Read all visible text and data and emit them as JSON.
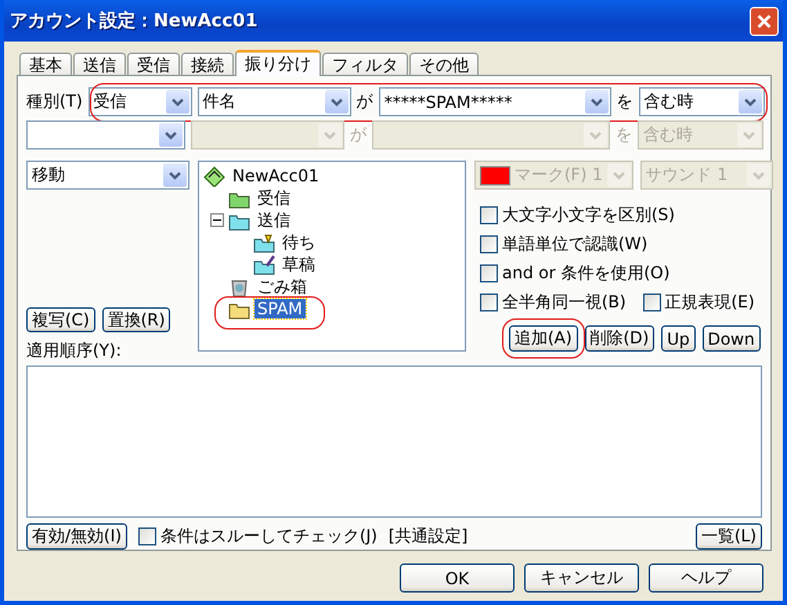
{
  "window": {
    "title": "アカウント設定：NewAcc01"
  },
  "tabs": [
    {
      "label": "基本",
      "selected": false
    },
    {
      "label": "送信",
      "selected": false
    },
    {
      "label": "受信",
      "selected": false
    },
    {
      "label": "接続",
      "selected": false
    },
    {
      "label": "振り分け",
      "selected": true
    },
    {
      "label": "フィルタ",
      "selected": false
    },
    {
      "label": "その他",
      "selected": false
    }
  ],
  "conditions": [
    {
      "label": "種別(T)",
      "type": "受信",
      "field": "件名",
      "particle_1": "が",
      "pattern": "*****SPAM*****",
      "particle_2": "を",
      "match": "含む時",
      "disabled": false,
      "highlighted": true
    },
    {
      "particle_1": "が",
      "particle_2": "を",
      "match": "含む時",
      "disabled": true,
      "highlighted": false
    }
  ],
  "action": {
    "value": "移動"
  },
  "folder_tree": [
    {
      "label": "NewAcc01",
      "kind": "account",
      "selected": false,
      "highlighted": false,
      "children": [
        {
          "label": "受信",
          "kind": "inbox",
          "selected": false,
          "highlighted": false
        },
        {
          "label": "送信",
          "kind": "outbox",
          "selected": false,
          "highlighted": false,
          "expanded": true,
          "children": [
            {
              "label": "待ち",
              "kind": "queue",
              "selected": false,
              "highlighted": false
            },
            {
              "label": "草稿",
              "kind": "draft",
              "selected": false,
              "highlighted": false
            }
          ]
        },
        {
          "label": "ごみ箱",
          "kind": "trash",
          "selected": false,
          "highlighted": false
        },
        {
          "label": "SPAM",
          "kind": "folder",
          "selected": true,
          "highlighted": true
        }
      ]
    }
  ],
  "mark": {
    "label": "マーク(F) 1",
    "color": "#ff0000",
    "disabled": true
  },
  "sound": {
    "label": "サウンド 1",
    "disabled": true
  },
  "option_rows": [
    [
      {
        "label": "大文字小文字を区別(S)",
        "checked": false
      }
    ],
    [
      {
        "label": "単語単位で認識(W)",
        "checked": false
      }
    ],
    [
      {
        "label": "and or 条件を使用(O)",
        "checked": false
      }
    ],
    [
      {
        "label": "全半角同一視(B)",
        "checked": false
      },
      {
        "label": "正規表現(E)",
        "checked": false
      }
    ]
  ],
  "left_buttons": [
    "複写(C)",
    "置換(R)"
  ],
  "rule_buttons": [
    {
      "label": "追加(A)",
      "highlighted": true
    },
    {
      "label": "削除(D)",
      "highlighted": false
    },
    {
      "label": "Up",
      "highlighted": false
    },
    {
      "label": "Down",
      "highlighted": false
    }
  ],
  "order_list": {
    "label": "適用順序(Y):"
  },
  "toggle_button": "有効/無効(I)",
  "through_check": {
    "label": "条件はスルーしてチェック(J)",
    "checked": false
  },
  "common_note": "[共通設定]",
  "list_button": "一覧(L)",
  "dialog_buttons": [
    "OK",
    "キャンセル",
    "ヘルプ"
  ]
}
